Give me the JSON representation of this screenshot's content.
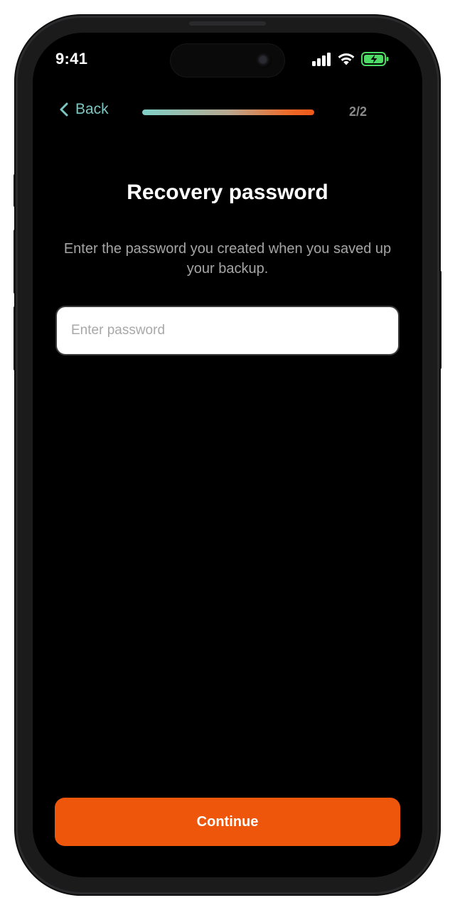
{
  "status_bar": {
    "time": "9:41",
    "icons": [
      "signal-icon",
      "wifi-icon",
      "battery-charging-icon"
    ],
    "battery_color": "#4cd964"
  },
  "nav": {
    "back_label": "Back",
    "progress": 1.0,
    "step_counter": "2/2"
  },
  "content": {
    "title": "Recovery password",
    "subtitle": "Enter the password you created when you saved up your backup.",
    "password_placeholder": "Enter password",
    "password_value": ""
  },
  "footer": {
    "continue_label": "Continue"
  },
  "colors": {
    "accent": "#ee560b",
    "back_link": "#7cc6c2",
    "background": "#000000"
  }
}
